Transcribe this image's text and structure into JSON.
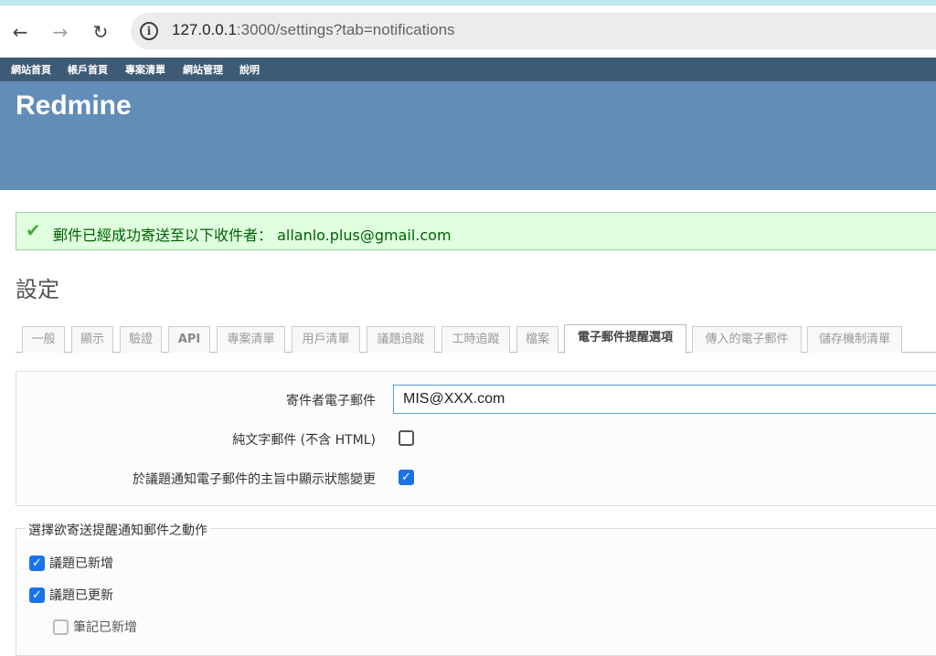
{
  "browser": {
    "url_host": "127.0.0.1",
    "url_rest": ":3000/settings?tab=notifications",
    "back_glyph": "←",
    "forward_glyph": "→",
    "reload_glyph": "↻",
    "info_glyph": "i"
  },
  "top_menu": [
    "網站首頁",
    "帳戶首頁",
    "專案清單",
    "網站管理",
    "說明"
  ],
  "header": {
    "title": "Redmine"
  },
  "flash": {
    "message": "郵件已經成功寄送至以下收件者： allanlo.plus@gmail.com",
    "check_glyph": "✔"
  },
  "page": {
    "title": "設定"
  },
  "tabs": [
    {
      "label": "一般",
      "selected": false
    },
    {
      "label": "顯示",
      "selected": false
    },
    {
      "label": "驗證",
      "selected": false
    },
    {
      "label": "API",
      "selected": false
    },
    {
      "label": "專案清單",
      "selected": false
    },
    {
      "label": "用戶清單",
      "selected": false
    },
    {
      "label": "議題追蹤",
      "selected": false
    },
    {
      "label": "工時追蹤",
      "selected": false
    },
    {
      "label": "檔案",
      "selected": false
    },
    {
      "label": "電子郵件提醒選項",
      "selected": true
    },
    {
      "label": "傳入的電子郵件",
      "selected": false
    },
    {
      "label": "儲存機制清單",
      "selected": false
    }
  ],
  "settings": {
    "sender_label": "寄件者電子郵件",
    "sender_value": "MIS@XXX.com",
    "plain_text_label": "純文字郵件 (不含 HTML)",
    "plain_text_checked": false,
    "status_subject_label": "於議題通知電子郵件的主旨中顯示狀態變更",
    "status_subject_checked": true
  },
  "notifications": {
    "legend": "選擇欲寄送提醒通知郵件之動作",
    "items": [
      {
        "label": "議題已新增",
        "checked": true,
        "disabled": false
      },
      {
        "label": "議題已更新",
        "checked": true,
        "disabled": false
      },
      {
        "label": "筆記已新增",
        "checked": false,
        "disabled": true
      }
    ]
  },
  "colors": {
    "header": "#628db6",
    "top_menu": "#3e5b76",
    "flash_bg": "#dfffdf",
    "checkbox_on": "#1a73e8"
  }
}
